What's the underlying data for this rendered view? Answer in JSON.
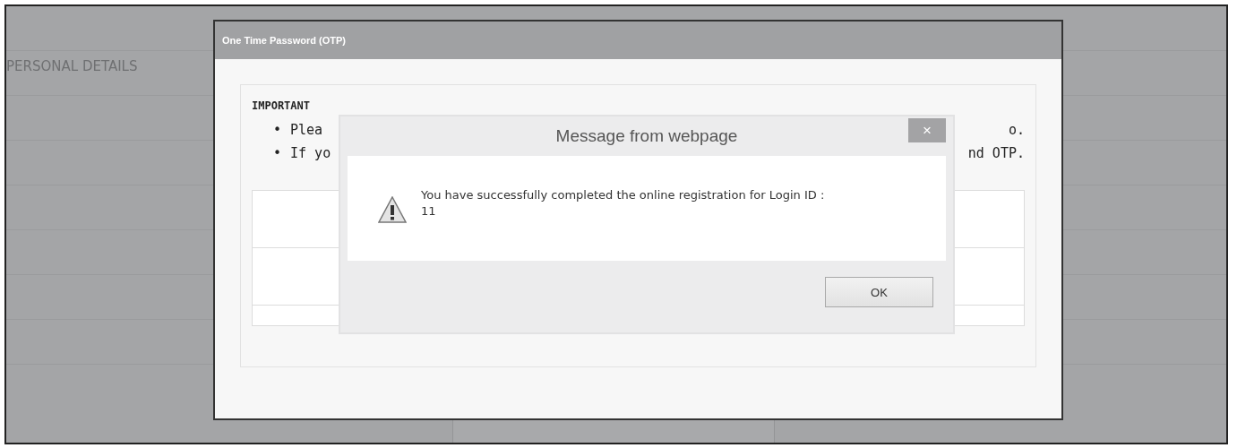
{
  "page": {
    "section_title": "PERSONAL DETAILS"
  },
  "otp_dialog": {
    "title": "One Time Password (OTP)",
    "heading": "IMPORTANT",
    "bullets": [
      {
        "bullet": "•",
        "start": "Plea",
        "end": "o."
      },
      {
        "bullet": "•",
        "start": "If yo",
        "end": "nd OTP."
      }
    ]
  },
  "message_dialog": {
    "title": "Message from webpage",
    "close": "×",
    "message": "You have successfully completed the online registration for Login ID :",
    "login_id": "11",
    "button": "OK"
  }
}
